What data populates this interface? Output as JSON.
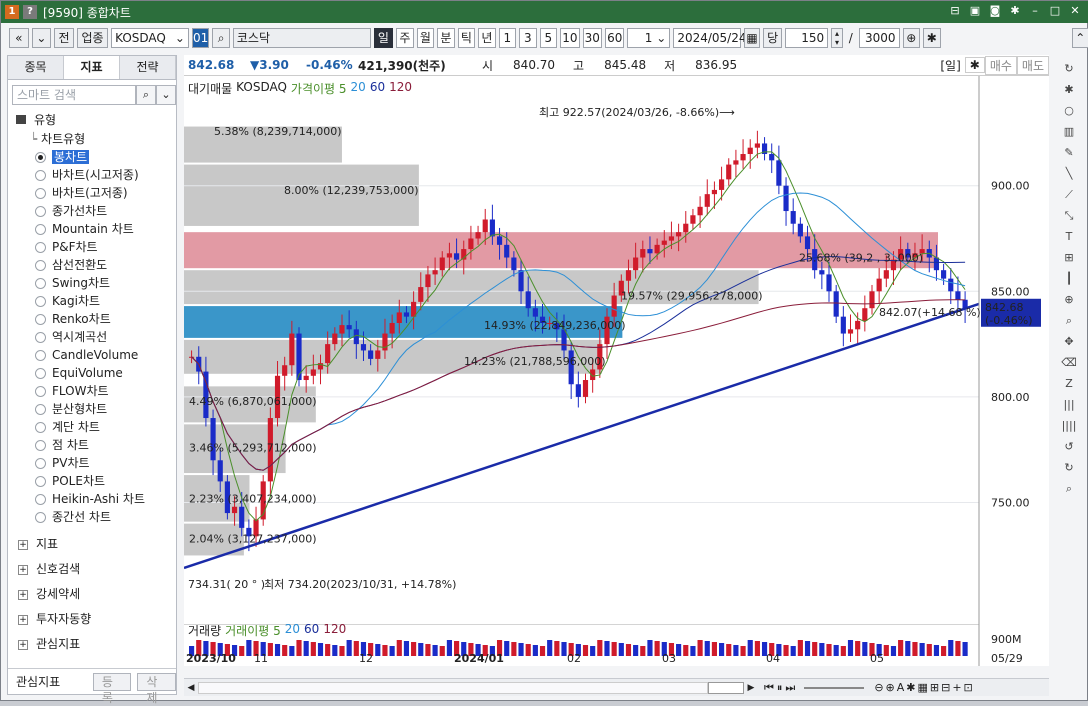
{
  "window": {
    "icon1": "1",
    "icon2": "?",
    "title": "[9590] 종합차트",
    "btn_icons": [
      "camera-icon",
      "camera-icon",
      "camera-icon",
      "gear-icon",
      "minimize-icon",
      "maximize-icon",
      "close-icon"
    ]
  },
  "toolbar": {
    "nav_prev": "«",
    "nav_drop": "»",
    "prev_label": "전",
    "market": "업종",
    "code": "KOSDAQ",
    "code_num": "01",
    "search_icon": "⌕",
    "name": "코스닥",
    "periods": [
      "일",
      "주",
      "월",
      "분",
      "틱",
      "년"
    ],
    "minutes": [
      "1",
      "3",
      "5",
      "10",
      "30",
      "60"
    ],
    "count_field": "1",
    "date": "2024/05/24",
    "unit": "당",
    "bars": "150",
    "slash": "/",
    "total": "3000"
  },
  "leftpanel": {
    "tabs": [
      "종목",
      "지표",
      "전략"
    ],
    "active_tab": 1,
    "search_placeholder": "스마트 검색",
    "section": "유형",
    "subsection": "차트유형",
    "chart_types": [
      "봉차트",
      "바차트(시고저종)",
      "바차트(고저종)",
      "종가선차트",
      "Mountain 차트",
      "P&F차트",
      "삼선전환도",
      "Swing차트",
      "Kagi차트",
      "Renko차트",
      "역시계곡선",
      "CandleVolume",
      "EquiVolume",
      "FLOW차트",
      "분산형차트",
      "계단 차트",
      "점 차트",
      "PV차트",
      "POLE차트",
      "Heikin-Ashi 차트",
      "종간선 차트"
    ],
    "selected": 0,
    "groups": [
      "지표",
      "신호검색",
      "강세약세",
      "투자자동향",
      "관심지표"
    ],
    "bottom_label": "관심지표",
    "btn_register": "등록",
    "btn_delete": "삭제"
  },
  "price": {
    "close": "842.68",
    "change": "▼3.90",
    "pct": "-0.46%",
    "volume": "421,390(천주)",
    "open_label": "시",
    "open": "840.70",
    "high_label": "고",
    "high": "845.48",
    "low_label": "저",
    "low": "836.95",
    "period_tag": "[일]",
    "tag_buy": "매수",
    "tag_sell": "매도"
  },
  "legend": {
    "items": [
      "대기매물",
      "KOSDAQ",
      "가격이평 5",
      "20",
      "60",
      "120"
    ]
  },
  "annotations": {
    "max": "최고 922.57(2024/03/26, -8.66%)⟶",
    "min": "최저 734.20(2023/10/31, +14.78%)",
    "trend": "734.31( 20 ° )",
    "trend_end": "842.07(+14.68 %)",
    "last_price": "842.68",
    "last_pct": "(-0.46%)"
  },
  "volume_profile": [
    {
      "label": "5.38% (8,239,714,000)"
    },
    {
      "label": "8.00% (12,239,753,000)"
    },
    {
      "label": "25.68% (39,2 , 3 ,000)"
    },
    {
      "label": "19.57% (29,956,278,000)"
    },
    {
      "label": "14.93% (22,849,236,000)"
    },
    {
      "label": "14.23% (21,788,596,000)"
    },
    {
      "label": "4.49% (6,870,061,000)"
    },
    {
      "label": "3.46% (5,293,712,000)"
    },
    {
      "label": "2.23% (3,407,234,000)"
    },
    {
      "label": "2.04% (3,127,237,000)"
    }
  ],
  "volume_panel": {
    "legend": [
      "거래량",
      "거래이평 5",
      "20",
      "60",
      "120"
    ],
    "yaxis": "900M"
  },
  "chart_data": {
    "type": "candlestick",
    "symbol": "KOSDAQ",
    "yticks": [
      750,
      800,
      850,
      900
    ],
    "ylim": [
      719,
      933
    ],
    "x_labels": [
      "2023/10",
      "11",
      "12",
      "2024/01",
      "02",
      "03",
      "04",
      "05"
    ],
    "date_right": "05/29",
    "key_points": [
      {
        "date": "2023/10/31",
        "price": 734.2,
        "label": "min"
      },
      {
        "date": "2024/03/26",
        "price": 922.57,
        "label": "max"
      },
      {
        "date": "2024/05/24",
        "price": 842.68,
        "label": "last"
      }
    ],
    "close_series": [
      819,
      812,
      790,
      770,
      760,
      745,
      748,
      738,
      734,
      742,
      760,
      790,
      810,
      815,
      830,
      808,
      810,
      813,
      816,
      825,
      830,
      834,
      832,
      825,
      822,
      818,
      822,
      830,
      835,
      840,
      838,
      845,
      852,
      858,
      860,
      866,
      868,
      865,
      870,
      875,
      878,
      884,
      876,
      872,
      866,
      860,
      850,
      842,
      838,
      835,
      835,
      832,
      822,
      806,
      800,
      808,
      813,
      825,
      838,
      848,
      855,
      860,
      866,
      870,
      868,
      872,
      874,
      876,
      878,
      882,
      886,
      890,
      896,
      898,
      903,
      910,
      912,
      915,
      918,
      920,
      915,
      912,
      900,
      888,
      882,
      876,
      870,
      860,
      858,
      850,
      838,
      830,
      832,
      836,
      842,
      850,
      856,
      860,
      865,
      870,
      866,
      868,
      870,
      866,
      860,
      856,
      850,
      846,
      842
    ],
    "volume_profile_pct": [
      5.38,
      8.0,
      25.68,
      19.57,
      14.93,
      14.23,
      4.49,
      3.46,
      2.23,
      2.04
    ],
    "ma_periods": [
      5,
      20,
      60,
      120
    ]
  },
  "right_axis": {
    "y900": "900.00",
    "y850": "850.00",
    "y800": "800.00",
    "y750": "750.00"
  }
}
